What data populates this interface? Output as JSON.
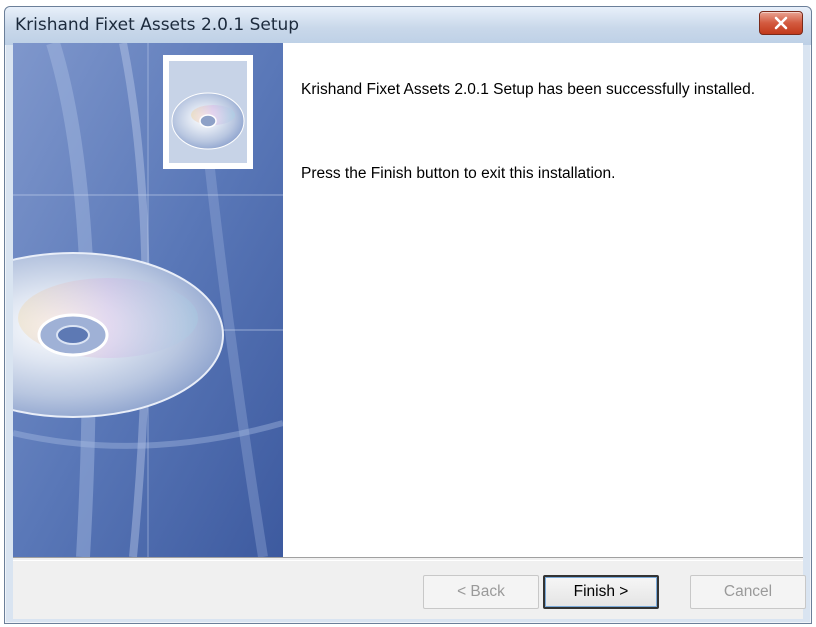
{
  "window": {
    "title": "Krishand Fixet Assets 2.0.1 Setup"
  },
  "content": {
    "success_message": "Krishand Fixet Assets 2.0.1 Setup has been successfully installed.",
    "instruction": "Press the Finish button to exit this installation."
  },
  "buttons": {
    "back": "< Back",
    "finish": "Finish >",
    "cancel": "Cancel"
  },
  "colors": {
    "close_button": "#c2391b",
    "side_panel": "#4f6fb0"
  },
  "icons": {
    "close": "close-icon",
    "cd": "cd-icon"
  }
}
